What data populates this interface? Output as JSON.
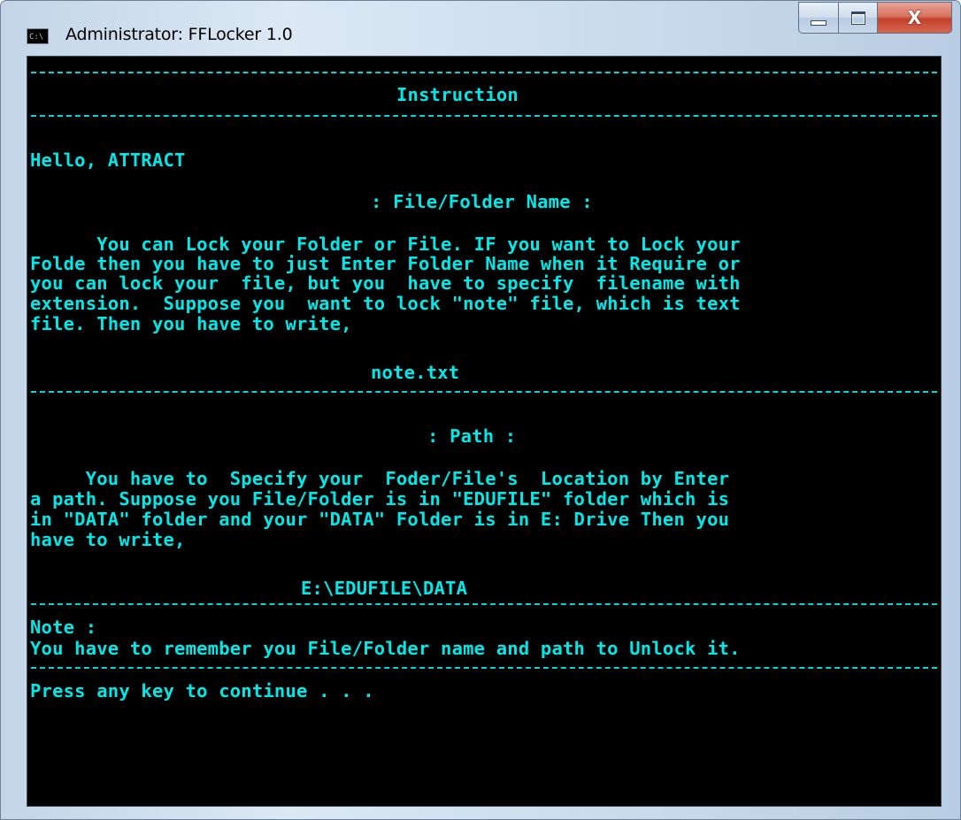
{
  "window": {
    "title": "Administrator:  FFLocker 1.0",
    "icon_label": "C:\\",
    "buttons": {
      "minimize_icon": "minimize-icon",
      "maximize_icon": "maximize-icon",
      "close_glyph": "X"
    }
  },
  "console": {
    "text_color": "#00e8e8",
    "background": "#000000",
    "heading": "Instruction",
    "greeting": "Hello, ATTRACT",
    "section1_title": ": File/Folder Name :",
    "section1_lines": [
      "      You can Lock your Folder or File. IF you want to Lock your",
      "Folde then you have to just Enter Folder Name when it Require or",
      "you can lock your  file, but you  have to specify  filename with",
      "extension.  Suppose you  want to lock \"note\" file, which is text",
      "file. Then you have to write,"
    ],
    "section1_example": "note.txt",
    "section2_title": ": Path :",
    "section2_lines": [
      "     You have to  Specify your  Foder/File's  Location by Enter",
      "a path. Suppose you File/Folder is in \"EDUFILE\" folder which is",
      "in \"DATA\" folder and your \"DATA\" Folder is in E: Drive Then you",
      "have to write,"
    ],
    "section2_example": "E:\\EDUFILE\\DATA",
    "note_label": "Note :",
    "note_text": "You have to remember you File/Folder name and path to Unlock it.",
    "prompt": "Press any key to continue . . ."
  }
}
